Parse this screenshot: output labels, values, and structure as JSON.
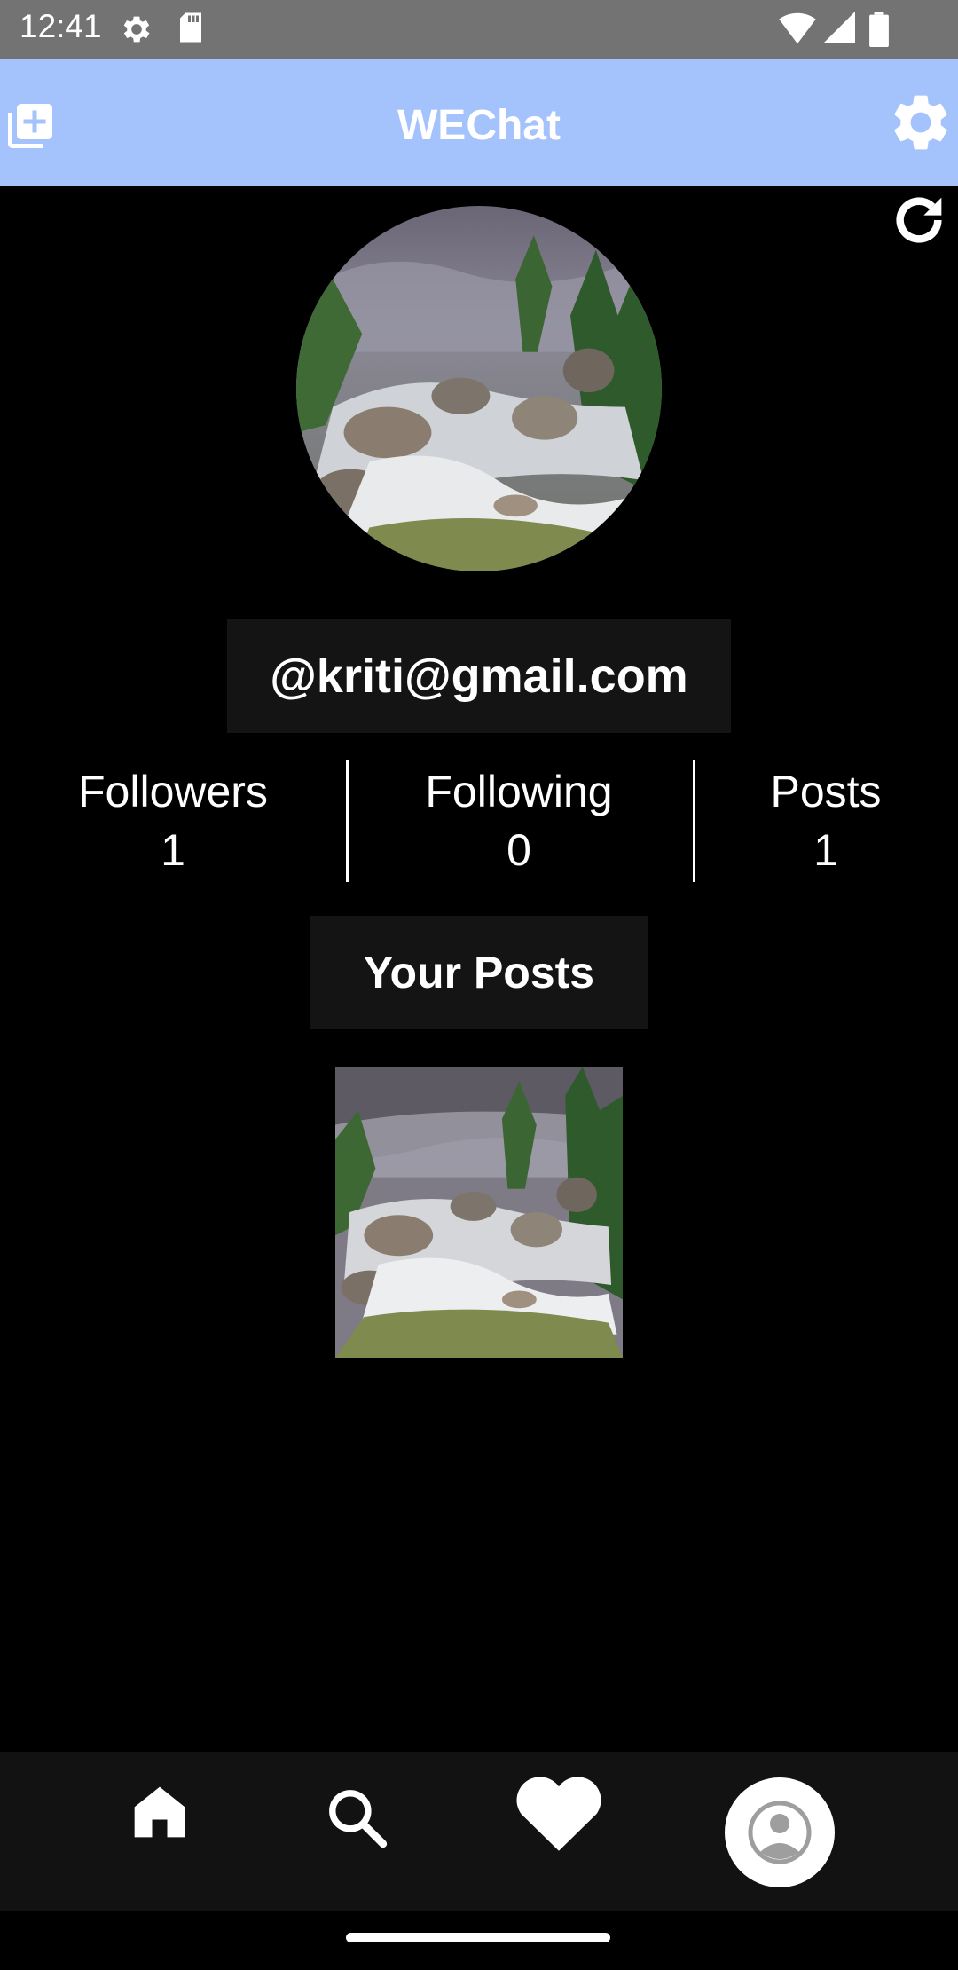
{
  "status_bar": {
    "time": "12:41",
    "icons": [
      "settings-status-icon",
      "sd-card-icon",
      "wifi-icon",
      "signal-icon",
      "battery-icon"
    ]
  },
  "app_bar": {
    "title": "WEChat",
    "left_icon": "add-post-icon",
    "right_icon": "gear-icon",
    "background": "#a4c2fb"
  },
  "profile": {
    "refresh_icon": "refresh-icon",
    "avatar_icon": "avatar-image",
    "email": "@kriti@gmail.com"
  },
  "stats": [
    {
      "label": "Followers",
      "value": "1"
    },
    {
      "label": "Following",
      "value": "0"
    },
    {
      "label": "Posts",
      "value": "1"
    }
  ],
  "posts_section": {
    "title": "Your Posts"
  },
  "bottom_nav": {
    "items": [
      "home-icon",
      "search-icon",
      "heart-icon",
      "profile-icon"
    ],
    "active": "profile-icon"
  }
}
